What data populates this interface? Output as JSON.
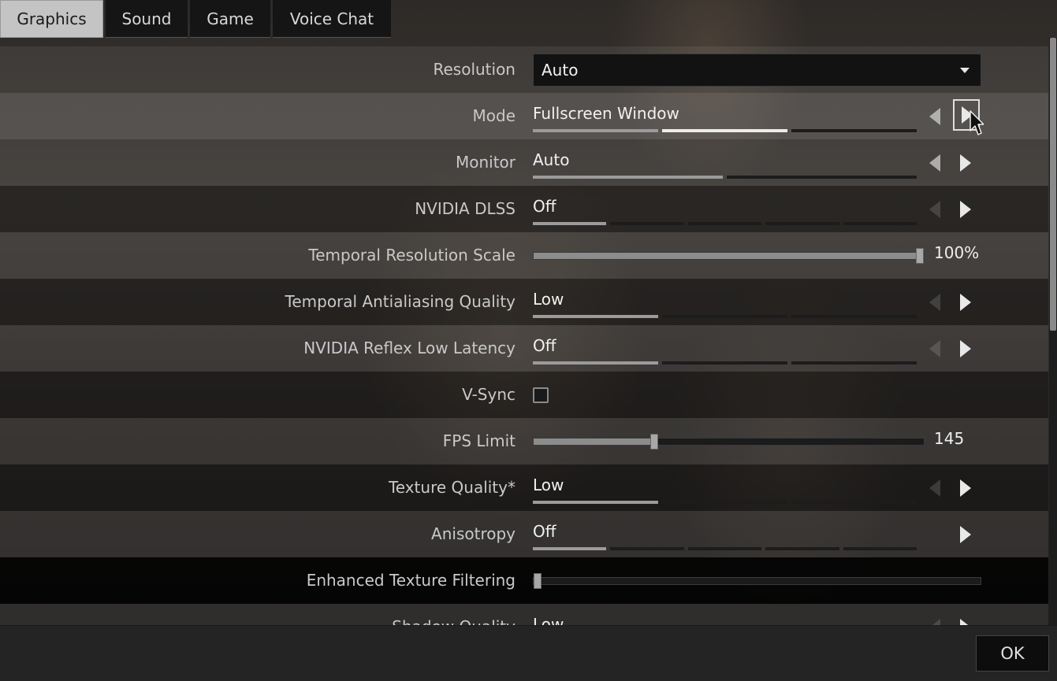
{
  "tabs": [
    {
      "label": "Graphics",
      "active": true
    },
    {
      "label": "Sound",
      "active": false
    },
    {
      "label": "Game",
      "active": false
    },
    {
      "label": "Voice Chat",
      "active": false
    }
  ],
  "settings": {
    "resolution": {
      "label": "Resolution",
      "value": "Auto"
    },
    "mode": {
      "label": "Mode",
      "value": "Fullscreen Window",
      "step": 2,
      "steps": 3
    },
    "monitor": {
      "label": "Monitor",
      "value": "Auto",
      "step": 1,
      "steps": 2
    },
    "dlss": {
      "label": "NVIDIA DLSS",
      "value": "Off",
      "step": 1,
      "steps": 5
    },
    "temporal_scale": {
      "label": "Temporal Resolution Scale",
      "value": "100%",
      "fraction": 1.0
    },
    "taa_quality": {
      "label": "Temporal Antialiasing Quality",
      "value": "Low",
      "step": 1,
      "steps": 3
    },
    "reflex": {
      "label": "NVIDIA Reflex Low Latency",
      "value": "Off",
      "step": 1,
      "steps": 3
    },
    "vsync": {
      "label": "V-Sync",
      "checked": false
    },
    "fps_limit": {
      "label": "FPS Limit",
      "value": "145",
      "fraction": 0.31
    },
    "texture_quality": {
      "label": "Texture Quality*",
      "value": "Low",
      "step": 1,
      "steps": 3
    },
    "anisotropy": {
      "label": "Anisotropy",
      "value": "Off",
      "step": 1,
      "steps": 5
    },
    "enhanced_texture_filtering": {
      "label": "Enhanced Texture Filtering",
      "fraction": 0.0
    },
    "shadow_quality": {
      "label": "Shadow Quality",
      "value": "Low"
    }
  },
  "footer": {
    "ok_label": "OK"
  },
  "colors": {
    "active_tab_bg": "#c4c4c4",
    "accent_white": "#ececec"
  },
  "icons": {
    "dropdown": "caret-down-icon",
    "prev": "arrow-left-icon",
    "next": "arrow-right-icon",
    "cursor": "mouse-cursor-icon"
  }
}
